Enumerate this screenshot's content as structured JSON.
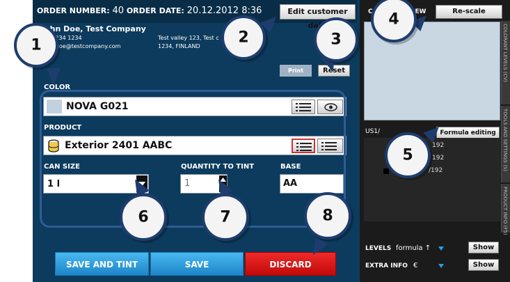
{
  "header": {
    "order_number_label": "ORDER NUMBER:",
    "order_number": "40",
    "order_date_label": "ORDER DATE:",
    "order_date": "20.12.2012 8:36",
    "edit_customer_label": "Edit customer data"
  },
  "customer": {
    "name": "John Doe, Test Company",
    "phone": "+1 1234 1234",
    "email": "john.doe@testcompany.com",
    "address_line1": "Test valley 123, Test c",
    "address_line2": "1234, FINLAND"
  },
  "actions": {
    "print_label": "Print",
    "reset_label": "Reset"
  },
  "color": {
    "label": "COLOR",
    "value": "NOVA G021"
  },
  "product": {
    "label": "PRODUCT",
    "value": "Exterior 2401 AABC"
  },
  "can_size": {
    "label": "CAN SIZE",
    "value": "1 l"
  },
  "quantity": {
    "label": "QUANTITY TO TINT",
    "value": "1"
  },
  "base": {
    "label": "BASE",
    "value": "AA"
  },
  "bottom_buttons": {
    "save_and_tint": "SAVE AND TINT",
    "save": "SAVE",
    "discard": "DISCARD"
  },
  "right_panel": {
    "preview_title": "COLOR PREVIEW",
    "rescale_label": "Re-scale formula",
    "unit_label": "US1/",
    "formula_editing_label": "Formula editing",
    "formula_rows": [
      "192",
      "192",
      "/192"
    ],
    "levels_label": "LEVELS",
    "levels_value": "formula ↑",
    "extra_info_label": "EXTRA INFO",
    "extra_info_value": "€",
    "show_label": "Show",
    "side_tabs": [
      "COLORANT LEVELS (CV)",
      "TOOLS AND SETTINGS (S)",
      "PRODUCT INFO (F5)"
    ]
  },
  "callouts": [
    "1",
    "2",
    "3",
    "4",
    "5",
    "6",
    "7",
    "8"
  ],
  "colors": {
    "app_bg": "#0d3b5d",
    "header_bg": "#0a2d47",
    "group_border": "#2d5c97",
    "blue_button": "#1d86c8",
    "red_button": "#c30a0a",
    "callout_border": "#1e3d6e"
  }
}
